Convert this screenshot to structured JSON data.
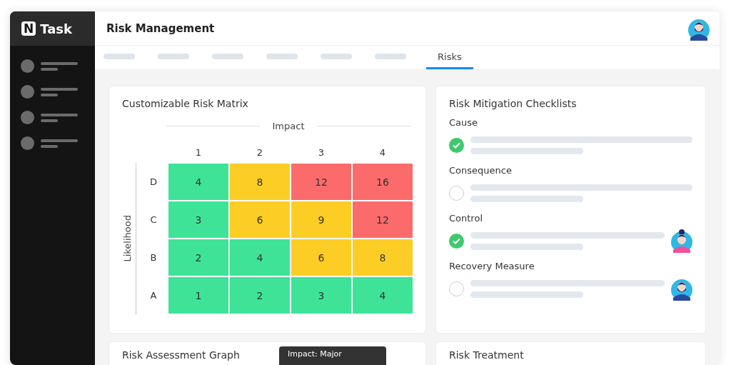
{
  "app": {
    "logo_mark": "N",
    "logo_text": "Task"
  },
  "header": {
    "title": "Risk Management",
    "avatar": {
      "kind": "male"
    }
  },
  "tabs": [
    {
      "kind": "placeholder",
      "selected": false
    },
    {
      "kind": "placeholder",
      "selected": false
    },
    {
      "kind": "placeholder",
      "selected": false
    },
    {
      "kind": "placeholder",
      "selected": false
    },
    {
      "kind": "placeholder",
      "selected": false
    },
    {
      "kind": "placeholder",
      "selected": false
    },
    {
      "kind": "text",
      "label": "Risks",
      "selected": true
    }
  ],
  "matrix_card": {
    "title": "Customizable Risk Matrix",
    "x_axis": "Impact",
    "y_axis": "Likelihood",
    "columns": [
      "1",
      "2",
      "3",
      "4"
    ],
    "rows": [
      {
        "label": "D",
        "cells": [
          {
            "value": "4",
            "color": "#3ee398"
          },
          {
            "value": "8",
            "color": "#fccd25"
          },
          {
            "value": "12",
            "color": "#fb6b6b"
          },
          {
            "value": "16",
            "color": "#fb6b6b"
          }
        ]
      },
      {
        "label": "C",
        "cells": [
          {
            "value": "3",
            "color": "#3ee398"
          },
          {
            "value": "6",
            "color": "#fccd25"
          },
          {
            "value": "9",
            "color": "#fccd25"
          },
          {
            "value": "12",
            "color": "#fb6b6b"
          }
        ]
      },
      {
        "label": "B",
        "cells": [
          {
            "value": "2",
            "color": "#3ee398"
          },
          {
            "value": "4",
            "color": "#3ee398"
          },
          {
            "value": "6",
            "color": "#fccd25"
          },
          {
            "value": "8",
            "color": "#fccd25"
          }
        ]
      },
      {
        "label": "A",
        "cells": [
          {
            "value": "1",
            "color": "#3ee398"
          },
          {
            "value": "2",
            "color": "#3ee398"
          },
          {
            "value": "3",
            "color": "#3ee398"
          },
          {
            "value": "4",
            "color": "#3ee398"
          }
        ]
      }
    ]
  },
  "checklist_card": {
    "title": "Risk Mitigation Checklists",
    "items": [
      {
        "label": "Cause",
        "checked": true
      },
      {
        "label": "Consequence",
        "checked": false
      },
      {
        "label": "Control",
        "checked": true,
        "assignee": {
          "kind": "female"
        }
      },
      {
        "label": "Recovery Measure",
        "checked": false,
        "assignee": {
          "kind": "male"
        }
      }
    ]
  },
  "graph_card": {
    "title": "Risk Assessment Graph",
    "tooltip": "Impact: Major"
  },
  "treatment_card": {
    "title": "Risk Treatment"
  }
}
